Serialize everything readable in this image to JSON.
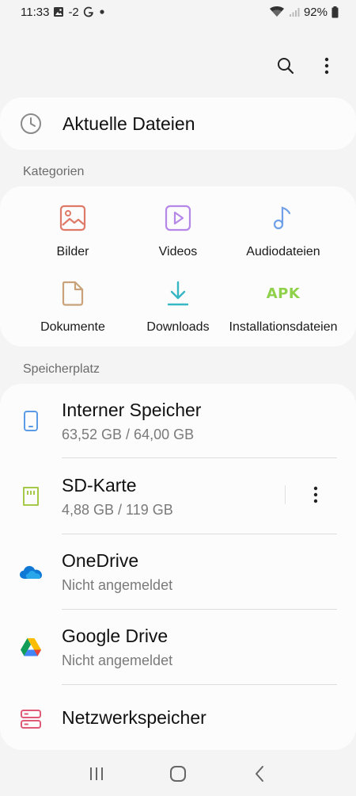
{
  "status_bar": {
    "time": "11:33",
    "temp": "-2",
    "battery": "92%"
  },
  "top_actions": {
    "icons": [
      "search-icon",
      "more-vert-icon"
    ]
  },
  "recent": {
    "label": "Aktuelle Dateien",
    "icon": "clock-icon"
  },
  "categories": {
    "header": "Kategorien",
    "items": [
      {
        "label": "Bilder",
        "icon": "image-icon",
        "color": "#e07a68"
      },
      {
        "label": "Videos",
        "icon": "video-icon",
        "color": "#b487e8"
      },
      {
        "label": "Audiodateien",
        "icon": "music-note-icon",
        "color": "#6fa0e8"
      },
      {
        "label": "Dokumente",
        "icon": "document-icon",
        "color": "#c9a27a"
      },
      {
        "label": "Downloads",
        "icon": "download-icon",
        "color": "#36b7c4"
      },
      {
        "label": "Installationsdateien",
        "icon_text": "APK",
        "color": "#8fd14b"
      }
    ]
  },
  "storage": {
    "header": "Speicherplatz",
    "items": [
      {
        "title": "Interner Speicher",
        "subtitle": "63,52 GB / 64,00 GB",
        "icon": "phone-icon",
        "color": "#5b9be6"
      },
      {
        "title": "SD-Karte",
        "subtitle": "4,88 GB / 119 GB",
        "icon": "sd-card-icon",
        "color": "#a7c94a"
      },
      {
        "title": "OneDrive",
        "subtitle": "Nicht angemeldet",
        "icon": "onedrive-icon",
        "color": "#0f78d4"
      },
      {
        "title": "Google Drive",
        "subtitle": "Nicht angemeldet",
        "icon": "google-drive-icon"
      },
      {
        "title": "Netzwerkspeicher",
        "icon": "network-storage-icon",
        "color": "#e05a78"
      }
    ]
  },
  "nav": {
    "icons": [
      "recent-apps-icon",
      "home-icon",
      "back-icon"
    ]
  }
}
